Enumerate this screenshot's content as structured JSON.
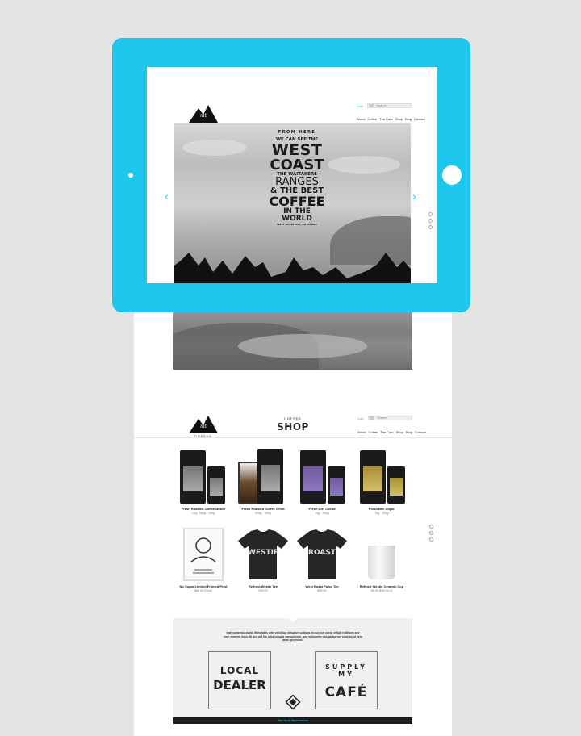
{
  "colors": {
    "accent": "#1ec6ee",
    "device": "#1ec6ee",
    "dark": "#1b1b1b"
  },
  "brand": {
    "coffee_label": "COFFEE"
  },
  "header": {
    "cart": "Cart",
    "search_placeholder": "Search",
    "nav": [
      "About",
      "Coffee",
      "The Cars",
      "Shop",
      "Blog",
      "Contact"
    ]
  },
  "hero": {
    "lines": [
      "FROM HERE",
      "WE CAN SEE THE",
      "WEST",
      "COAST",
      "THE WAITAKERE",
      "RANGES",
      "& THE BEST",
      "COFFEE",
      "IN THE WORLD",
      "WEST AUCKLAND, AOTEAROA"
    ]
  },
  "shop": {
    "title_small": "COFFEE",
    "title": "SHOP",
    "products": [
      {
        "name": "Fresh Roasted Coffee Beans",
        "meta": "1kg · 500g · 250g"
      },
      {
        "name": "Fresh Roasted Coffee Grind",
        "meta": "500g · 250g"
      },
      {
        "name": "Fresh Diet Cocoa",
        "meta": "1kg · 250g"
      },
      {
        "name": "Fresh Bee Sugar",
        "meta": "1kg · 250g"
      },
      {
        "name": "No Sugar Limited Framed Print",
        "meta": "$80.00 (Gold)"
      },
      {
        "name": "Refined Westie Tee",
        "meta": "$35.00"
      },
      {
        "name": "West Roast Pulse Tee",
        "meta": "$35.00"
      },
      {
        "name": "Refined Westie Ceramic Cup",
        "meta": "$8.00 ($40 for 5)"
      }
    ],
    "tee_words": [
      "WESTIE",
      "ROAST"
    ]
  },
  "panel": {
    "intro": "Imin nonsequi asolit, Mandiatus alim velicilluc dolupturi quibuss int aut eur conly, officiti nullitium que core volorem imus dit que alit lite odut volupta consumenm, quo sulloomhe voluptatur ser volorum at vern arum que nosci.",
    "local_top": "LOCAL",
    "local_bottom": "DEALER",
    "supply_top": "SUPPLY MY",
    "supply_bottom": "CAFÉ",
    "footer": "Site by Ai Bumbaasss"
  }
}
